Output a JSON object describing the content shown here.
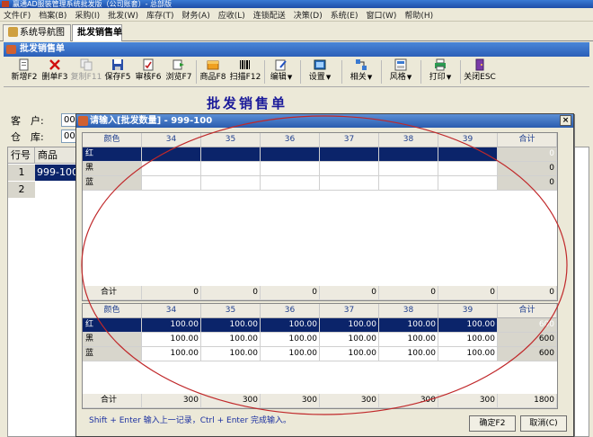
{
  "window": {
    "title": "赢通AD服装管理系统批发版（公司账套）- 总部版"
  },
  "menu": [
    "文件(F)",
    "档案(B)",
    "采购(I)",
    "批发(W)",
    "库存(T)",
    "财务(A)",
    "应收(L)",
    "连锁配送",
    "决策(D)",
    "系统(E)",
    "窗口(W)",
    "帮助(H)"
  ],
  "tabs": [
    {
      "label": "系统导航图"
    },
    {
      "label": "批发销售单"
    }
  ],
  "panel": {
    "title": "批发销售单"
  },
  "toolbar": [
    {
      "label": "新增F2",
      "icon": "new-doc-icon"
    },
    {
      "label": "删单F3",
      "icon": "delete-x-icon"
    },
    {
      "label": "复制F11",
      "icon": "copy-icon",
      "disabled": true
    },
    {
      "label": "保存F5",
      "icon": "save-icon"
    },
    {
      "label": "审核F6",
      "icon": "audit-icon"
    },
    {
      "label": "浏览F7",
      "icon": "browse-icon"
    },
    {
      "label": "商品F8",
      "icon": "goods-icon"
    },
    {
      "label": "扫描F12",
      "icon": "barcode-icon"
    },
    {
      "label": "编辑",
      "icon": "edit-icon"
    },
    {
      "label": "设置",
      "icon": "settings-icon"
    },
    {
      "label": "相关",
      "icon": "related-icon"
    },
    {
      "label": "风格",
      "icon": "style-icon"
    },
    {
      "label": "打印",
      "icon": "print-icon"
    },
    {
      "label": "关闭ESC",
      "icon": "close-door-icon"
    }
  ],
  "form": {
    "title": "批发销售单",
    "customer_label": "客　户:",
    "customer_value": "00",
    "warehouse_label": "仓　库:",
    "warehouse_value": "00"
  },
  "main_grid": {
    "headers": [
      "行号",
      "商品"
    ],
    "rows": [
      {
        "no": "1",
        "code": "999-100"
      },
      {
        "no": "2",
        "code": ""
      }
    ]
  },
  "dialog": {
    "title": "请输入[批发数量] - 999-100",
    "close": "×",
    "top_grid": {
      "headers": [
        "颜色",
        "34",
        "35",
        "36",
        "37",
        "38",
        "39",
        "合计"
      ],
      "rows": [
        {
          "color": "红",
          "values": [
            "",
            "",
            "",
            "",
            "",
            ""
          ],
          "total": "0"
        },
        {
          "color": "黑",
          "values": [
            "",
            "",
            "",
            "",
            "",
            ""
          ],
          "total": "0"
        },
        {
          "color": "蓝",
          "values": [
            "",
            "",
            "",
            "",
            "",
            ""
          ],
          "total": "0"
        }
      ],
      "footer": {
        "label": "合计",
        "values": [
          "0",
          "0",
          "0",
          "0",
          "0",
          "0"
        ],
        "total": "0"
      }
    },
    "bottom_grid": {
      "headers": [
        "颜色",
        "34",
        "35",
        "36",
        "37",
        "38",
        "39",
        "合计"
      ],
      "rows": [
        {
          "color": "红",
          "values": [
            "100.00",
            "100.00",
            "100.00",
            "100.00",
            "100.00",
            "100.00"
          ],
          "total": "600"
        },
        {
          "color": "黑",
          "values": [
            "100.00",
            "100.00",
            "100.00",
            "100.00",
            "100.00",
            "100.00"
          ],
          "total": "600"
        },
        {
          "color": "蓝",
          "values": [
            "100.00",
            "100.00",
            "100.00",
            "100.00",
            "100.00",
            "100.00"
          ],
          "total": "600"
        }
      ],
      "footer": {
        "label": "合计",
        "values": [
          "300",
          "300",
          "300",
          "300",
          "300",
          "300"
        ],
        "total": "1800"
      }
    },
    "hint": "Shift + Enter 输入上一记录，Ctrl + Enter 完成输入。",
    "ok_label": "确定F2",
    "cancel_label": "取消(C)"
  },
  "colors": {
    "selection": "#0b246a",
    "annotation": "#c0282a",
    "title_text": "#1a1a9a"
  }
}
